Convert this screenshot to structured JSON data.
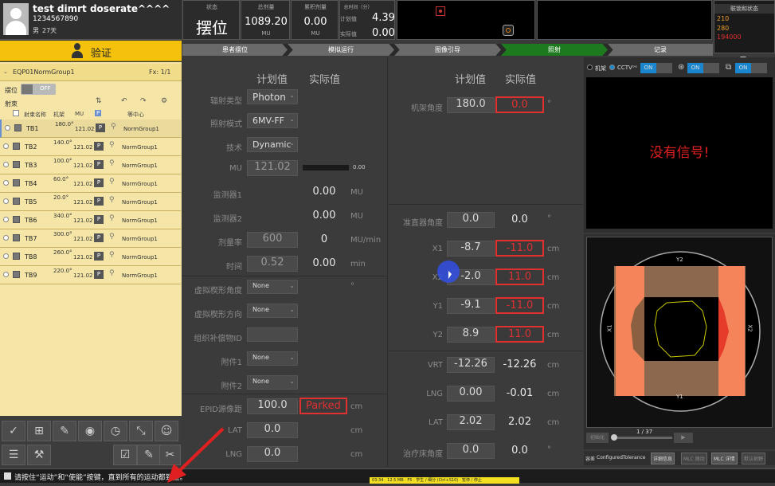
{
  "patient": {
    "name": "test dimrt doserate^^^^",
    "id": "1234567890",
    "sex": "男",
    "age": "27天"
  },
  "status": {
    "label": "状态",
    "value": "摆位"
  },
  "dose_total": {
    "label": "总剂量",
    "value": "1089.20",
    "unit": "MU"
  },
  "dose_accum": {
    "label": "累积剂量",
    "value": "0.00",
    "unit": "MU"
  },
  "time_total": {
    "label": "总时间（分）",
    "plan_label": "计划值",
    "plan": "4.39",
    "actual_label": "实际值",
    "actual": "0.00"
  },
  "interlock": {
    "title": "联锁和状态",
    "codes": [
      "210",
      "280",
      "194000"
    ]
  },
  "workflow": [
    "患者摆位",
    "模拟运行",
    "图像引导",
    "照射",
    "记录"
  ],
  "verify_label": "验证",
  "group": {
    "name": "EQP01NormGroup1",
    "fx": "Fx: 1/1"
  },
  "setup": {
    "label": "摆位",
    "toggle": "OFF"
  },
  "beams_title": "射束",
  "beam_headers": [
    "射束名称",
    "机架",
    "MU",
    "P",
    "等中心"
  ],
  "beams": [
    {
      "name": "TB1",
      "angle": "180.0°",
      "mu": "121.02",
      "p": "P",
      "iso": "NormGroup1"
    },
    {
      "name": "TB2",
      "angle": "140.0°",
      "mu": "121.02",
      "p": "P",
      "iso": "NormGroup1"
    },
    {
      "name": "TB3",
      "angle": "100.0°",
      "mu": "121.02",
      "p": "P",
      "iso": "NormGroup1"
    },
    {
      "name": "TB4",
      "angle": "60.0°",
      "mu": "121.02",
      "p": "P",
      "iso": "NormGroup1"
    },
    {
      "name": "TB5",
      "angle": "20.0°",
      "mu": "121.02",
      "p": "P",
      "iso": "NormGroup1"
    },
    {
      "name": "TB6",
      "angle": "340.0°",
      "mu": "121.02",
      "p": "P",
      "iso": "NormGroup1"
    },
    {
      "name": "TB7",
      "angle": "300.0°",
      "mu": "121.02",
      "p": "P",
      "iso": "NormGroup1"
    },
    {
      "name": "TB8",
      "angle": "260.0°",
      "mu": "121.02",
      "p": "P",
      "iso": "NormGroup1"
    },
    {
      "name": "TB9",
      "angle": "220.0°",
      "mu": "121.02",
      "p": "P",
      "iso": "NormGroup1"
    }
  ],
  "col_plan": "计划值",
  "col_actual": "实际值",
  "left_params": {
    "radiation_type": {
      "label": "辐射类型",
      "value": "Photon"
    },
    "mode": {
      "label": "照射模式",
      "value": "6MV-FF"
    },
    "technique": {
      "label": "技术",
      "value": "Dynamic"
    },
    "mu": {
      "label": "MU",
      "plan": "121.02",
      "progress_value": "0.00",
      "progress": 0
    },
    "monitor1": {
      "label": "监测器1",
      "actual": "0.00",
      "unit": "MU"
    },
    "monitor2": {
      "label": "监测器2",
      "actual": "0.00",
      "unit": "MU"
    },
    "dose_rate": {
      "label": "剂量率",
      "plan": "600",
      "actual": "0",
      "unit": "MU/min"
    },
    "time": {
      "label": "时间",
      "plan": "0.52",
      "actual": "0.00",
      "unit": "min"
    },
    "wedge_angle": {
      "label": "虚拟楔形角度",
      "value": "None"
    },
    "wedge_dir": {
      "label": "虚拟楔形方向",
      "value": "None"
    },
    "compensator": {
      "label": "组织补偿物ID"
    },
    "accessory1": {
      "label": "附件1",
      "value": "None"
    },
    "accessory2": {
      "label": "附件2",
      "value": "None"
    },
    "epid": {
      "label": "EPID源像距",
      "plan": "100.0",
      "actual": "Parked",
      "unit": "cm"
    },
    "lat": {
      "label": "LAT",
      "plan": "0.0",
      "unit": "cm"
    },
    "lng": {
      "label": "LNG",
      "plan": "0.0",
      "unit": "cm"
    }
  },
  "right_params": {
    "gantry": {
      "label": "机架角度",
      "plan": "180.0",
      "actual": "0.0",
      "unit": "°"
    },
    "collimator": {
      "label": "准直器角度",
      "plan": "0.0",
      "actual": "0.0",
      "unit": "°"
    },
    "x1": {
      "label": "X1",
      "plan": "-8.7",
      "actual": "-11.0",
      "unit": "cm"
    },
    "x2": {
      "label": "X2",
      "plan": "-2.0",
      "actual": "11.0",
      "unit": "cm"
    },
    "y1": {
      "label": "Y1",
      "plan": "-9.1",
      "actual": "-11.0",
      "unit": "cm"
    },
    "y2": {
      "label": "Y2",
      "plan": "8.9",
      "actual": "11.0",
      "unit": "cm"
    },
    "vrt": {
      "label": "VRT",
      "plan": "-12.26",
      "actual": "-12.26",
      "unit": "cm"
    },
    "lng": {
      "label": "LNG",
      "plan": "0.00",
      "actual": "-0.01",
      "unit": "cm"
    },
    "lat": {
      "label": "LAT",
      "plan": "2.02",
      "actual": "2.02",
      "unit": "cm"
    },
    "couch": {
      "label": "治疗床角度",
      "plan": "0.0",
      "actual": "0.0",
      "unit": "°"
    }
  },
  "camera": {
    "room_label": "机架",
    "cctv_label": "CCTV",
    "on": "ON",
    "no_signal": "没有信号!"
  },
  "bev": {
    "y2": "Y2",
    "y1": "Y1",
    "x1": "X1",
    "x2": "X2",
    "frame": "1 / 37",
    "start_label": "初始化"
  },
  "bottom_right": {
    "tolerance_label": "容差",
    "tolerance": "ConfiguredTolerance",
    "detail_btn": "详细信息",
    "mlc_mode": "MLC 随动",
    "mlc_detail": "MLC 详情",
    "default": "默认射野"
  },
  "status_message": "请按住“运动”和“使能”按键，直到所有的运动都到位。",
  "taskbar_text": "03:34 · 12.5 MB · F5 · 学生 / 细分 (Ctrl+S10) · 暂停 / 停止",
  "colors": {
    "accent_yellow": "#f4c20d",
    "alarm_red": "#e03030",
    "active_green": "#1e7a1e",
    "on_blue": "#1a86d0"
  }
}
